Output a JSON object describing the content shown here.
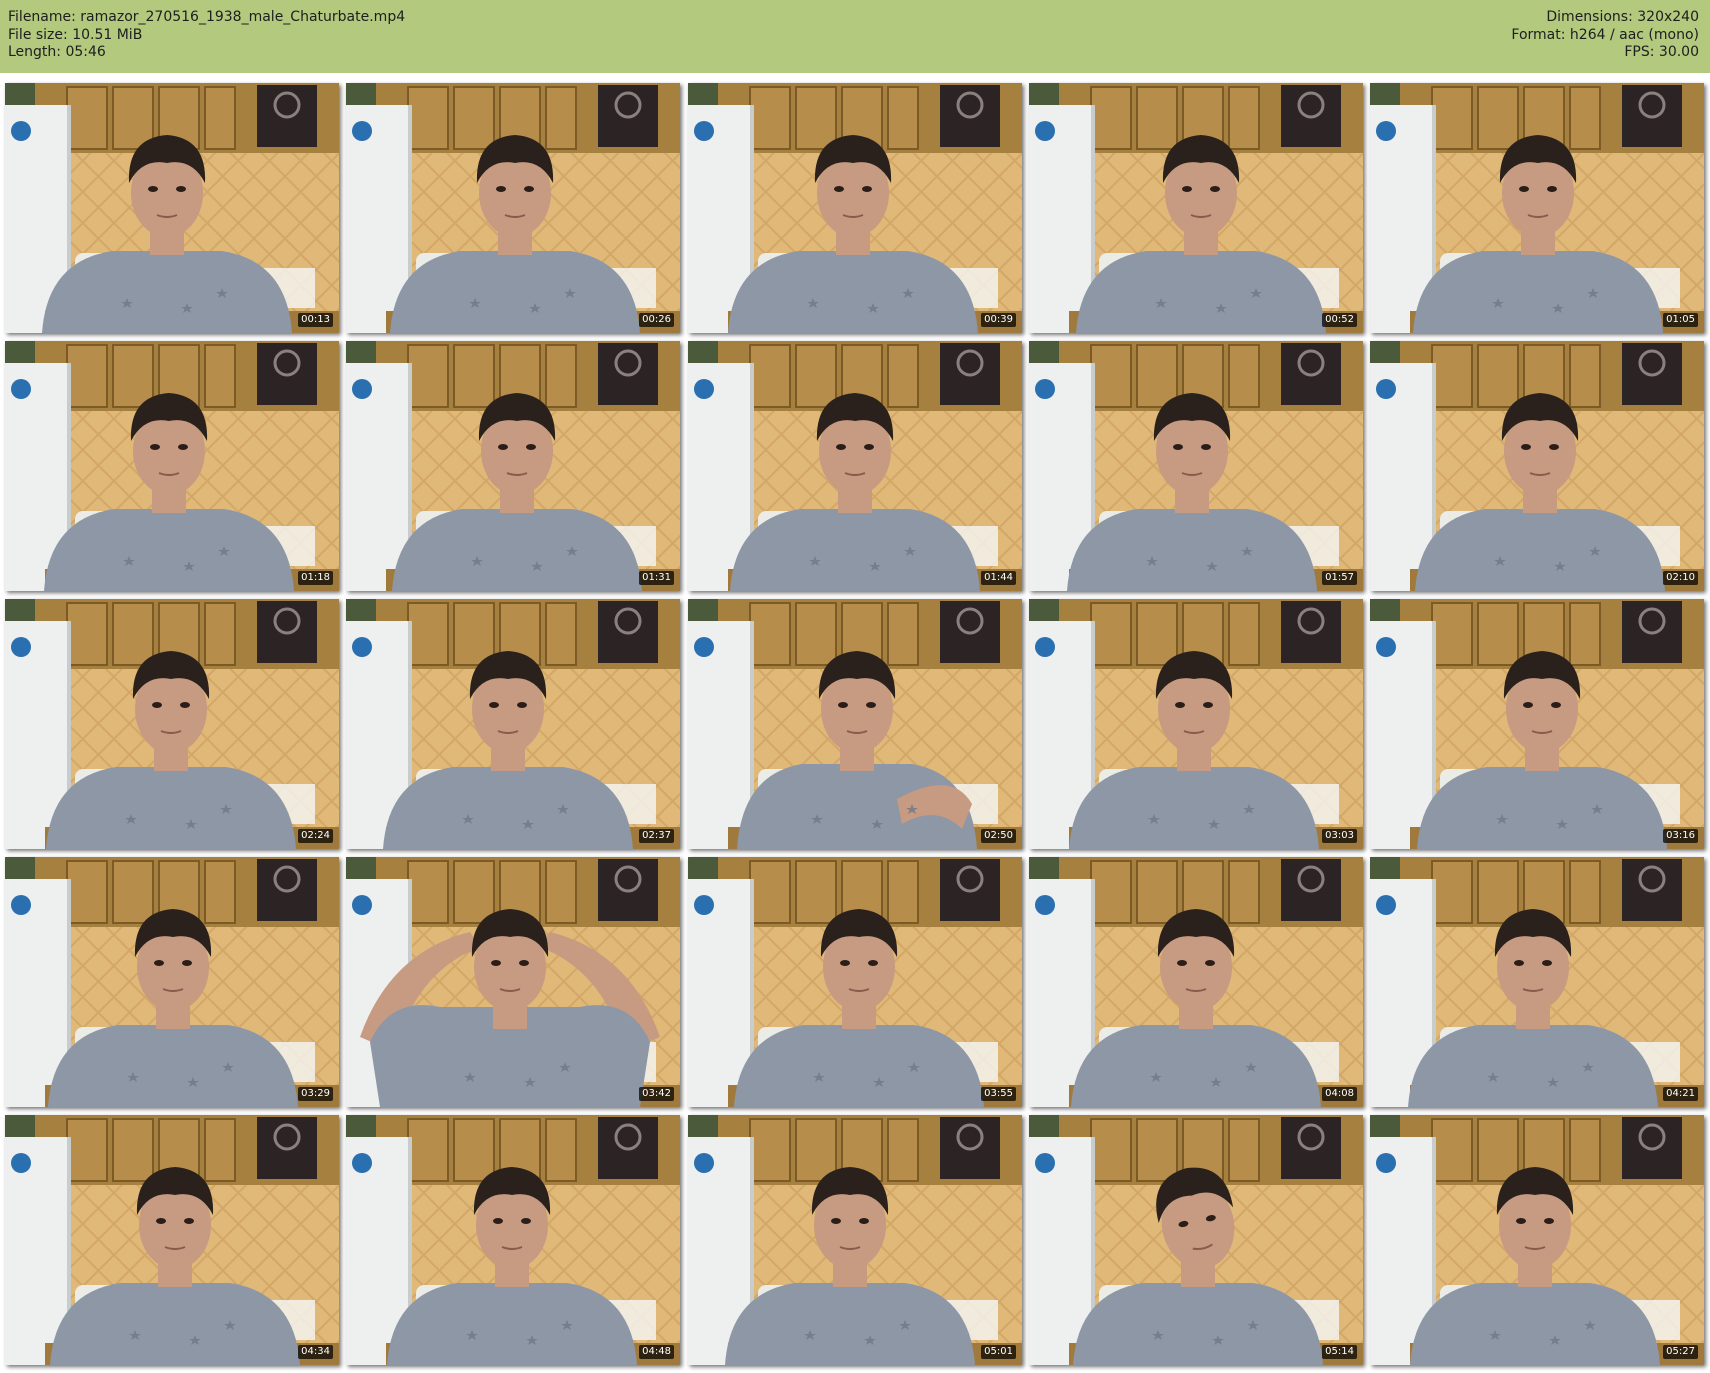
{
  "info": {
    "filename_line": "Filename: ramazor_270516_1938_male_Chaturbate.mp4",
    "filesize_line": "File size: 10.51 MiB",
    "length_line": "Length: 05:46",
    "dimensions_line": "Dimensions: 320x240",
    "format_line": "Format: h264 / aac (mono)",
    "fps_line": "FPS: 30.00"
  },
  "colors": {
    "header_bg": "#b2c97e",
    "page_bg": "#ffffff",
    "timestamp_bg": "#000000"
  },
  "thumbnails": [
    {
      "time": "00:13",
      "pose": "normal"
    },
    {
      "time": "00:26",
      "pose": "normal"
    },
    {
      "time": "00:39",
      "pose": "normal"
    },
    {
      "time": "00:52",
      "pose": "normal"
    },
    {
      "time": "01:05",
      "pose": "normal"
    },
    {
      "time": "01:18",
      "pose": "normal"
    },
    {
      "time": "01:31",
      "pose": "normal"
    },
    {
      "time": "01:44",
      "pose": "normal"
    },
    {
      "time": "01:57",
      "pose": "normal"
    },
    {
      "time": "02:10",
      "pose": "normal"
    },
    {
      "time": "02:24",
      "pose": "normal"
    },
    {
      "time": "02:37",
      "pose": "normal"
    },
    {
      "time": "02:50",
      "pose": "arm-raised"
    },
    {
      "time": "03:03",
      "pose": "normal"
    },
    {
      "time": "03:16",
      "pose": "normal"
    },
    {
      "time": "03:29",
      "pose": "normal"
    },
    {
      "time": "03:42",
      "pose": "hands-behind-head"
    },
    {
      "time": "03:55",
      "pose": "normal"
    },
    {
      "time": "04:08",
      "pose": "normal"
    },
    {
      "time": "04:21",
      "pose": "normal"
    },
    {
      "time": "04:34",
      "pose": "normal"
    },
    {
      "time": "04:48",
      "pose": "normal"
    },
    {
      "time": "05:01",
      "pose": "normal"
    },
    {
      "time": "05:14",
      "pose": "head-tilted"
    },
    {
      "time": "05:27",
      "pose": "normal"
    }
  ]
}
